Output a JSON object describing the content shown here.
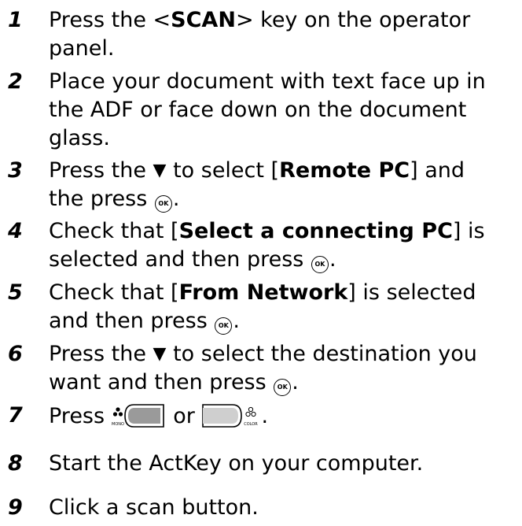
{
  "steps": [
    {
      "num": "1",
      "line1_pre": "Press the <",
      "line1_bold": "SCAN",
      "line1_post": "> key on the operator",
      "line2": "panel."
    },
    {
      "num": "2",
      "line1": "Place your document with text face up in",
      "line2": "the ADF or face down on the document",
      "line3": "glass."
    },
    {
      "num": "3",
      "line1_pre": "Press the",
      "line1_arrow": "▼",
      "line1_mid": "to select [",
      "line1_bold": "Remote PC",
      "line1_post": "] and",
      "line2_pre": "the press",
      "ok_label": "OK",
      "line2_post": "."
    },
    {
      "num": "4",
      "line1_pre": "Check that [",
      "line1_bold": "Select a connecting PC",
      "line1_post": "] is",
      "line2_pre": "selected and then press",
      "ok_label": "OK",
      "line2_post": "."
    },
    {
      "num": "5",
      "line1_pre": "Check that [",
      "line1_bold": "From Network",
      "line1_post": "] is selected",
      "line2_pre": "and then press",
      "ok_label": "OK",
      "line2_post": "."
    },
    {
      "num": "6",
      "line1_pre": "Press the",
      "line1_arrow": "▼",
      "line1_post": "to select the destination you",
      "line2_pre": "want and then press",
      "ok_label": "OK",
      "line2_post": "."
    },
    {
      "num": "7",
      "pre": "Press",
      "mono_label": "MONO",
      "mid": "or",
      "color_label": "COLOR",
      "post": "."
    },
    {
      "num": "8",
      "line1": "Start the ActKey on your computer."
    },
    {
      "num": "9",
      "line1": "Click a scan button."
    }
  ]
}
